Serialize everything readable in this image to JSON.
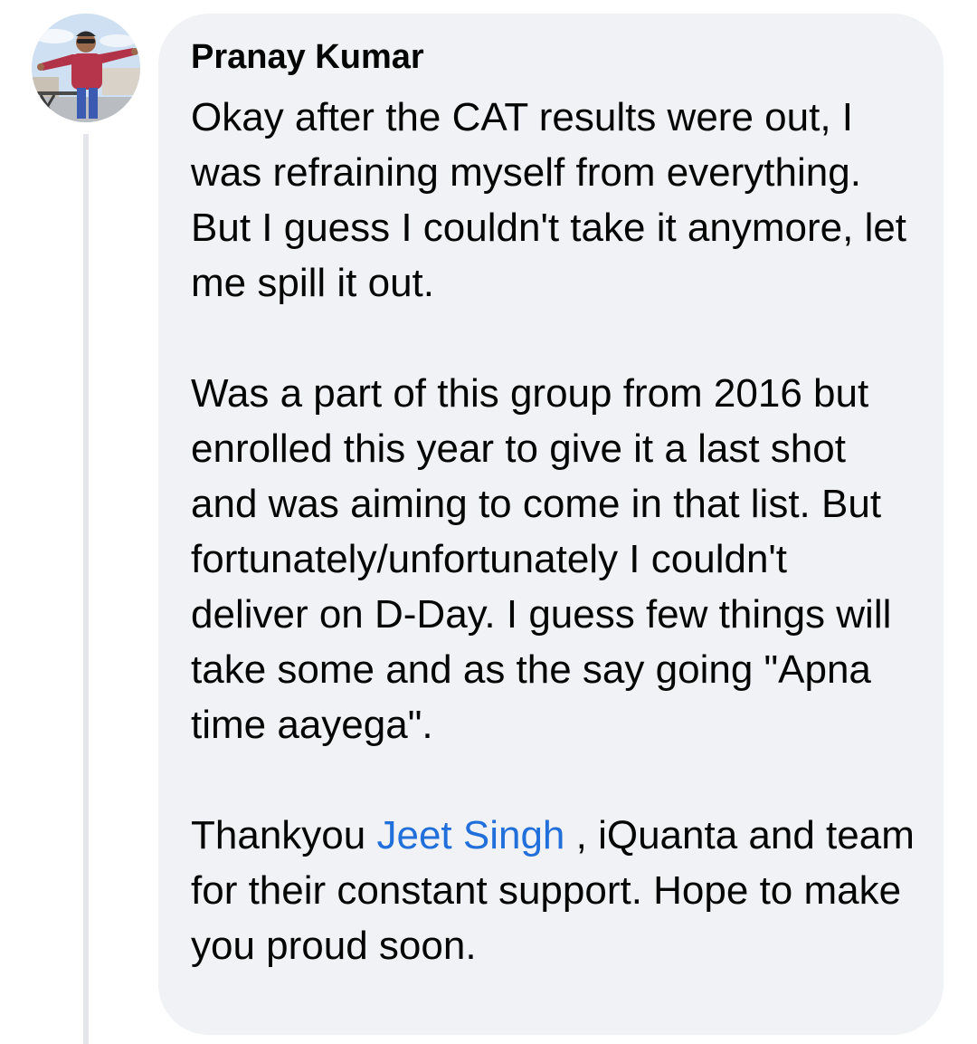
{
  "comment": {
    "author_name": "Pranay Kumar",
    "avatar_icon": "profile-photo-avatar",
    "paragraphs": {
      "p1": "Okay after the CAT results were out, I was refraining myself from everything. But I guess I couldn't take it anymore, let me spill it out.",
      "p2": "Was a part of this group from 2016 but enrolled this year to give it a last shot and was aiming to come in that list. But fortunately/unfortunately I couldn't deliver on D-Day. I guess few things will take some and as the say going \"Apna time aayega\".",
      "p3_before": "Thankyou ",
      "p3_mention": "Jeet Singh",
      "p3_after": " , iQuanta and team for their constant support. Hope to make you proud soon."
    }
  },
  "colors": {
    "bubble_bg": "#f0f2f5",
    "text": "#050505",
    "mention": "#216fdb",
    "thread_line": "#e4e6eb"
  }
}
